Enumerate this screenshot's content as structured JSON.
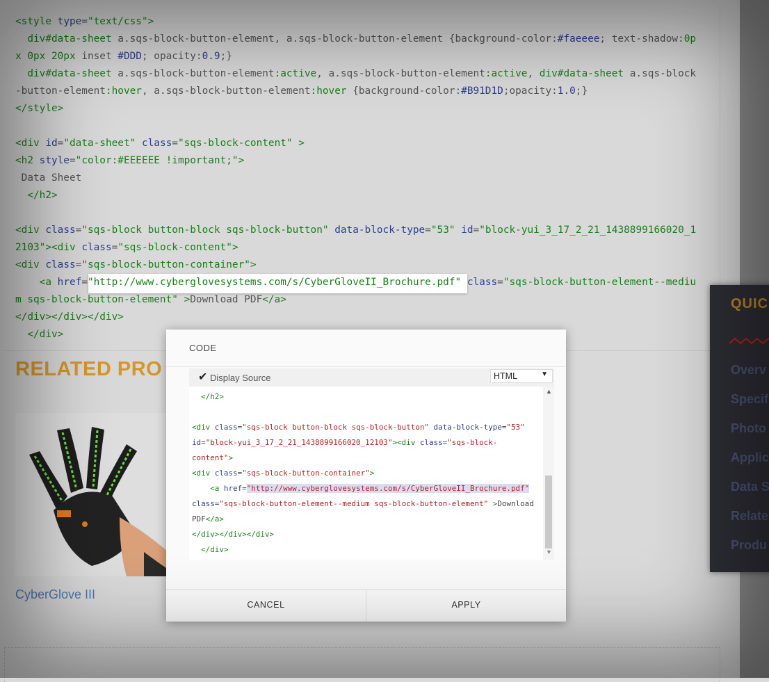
{
  "background_code": {
    "lines": [
      [
        {
          "c": "t",
          "v": "<style "
        },
        {
          "c": "a",
          "v": "type"
        },
        {
          "c": "p",
          "v": "="
        },
        {
          "c": "s",
          "v": "\"text/css\""
        },
        {
          "c": "t",
          "v": ">"
        }
      ],
      [
        {
          "c": "p",
          "v": "  "
        },
        {
          "c": "t",
          "v": "div#data-sheet"
        },
        {
          "c": "p",
          "v": " a.sqs-block-button-element, a.sqs-block-button-element "
        },
        {
          "c": "p",
          "v": "{background-color:"
        },
        {
          "c": "k",
          "v": "#faeeee"
        },
        {
          "c": "p",
          "v": "; text-shadow:"
        },
        {
          "c": "t",
          "v": "0p"
        }
      ],
      [
        {
          "c": "t",
          "v": "x 0px 20px"
        },
        {
          "c": "p",
          "v": " inset "
        },
        {
          "c": "k",
          "v": "#DDD"
        },
        {
          "c": "p",
          "v": "; opacity:"
        },
        {
          "c": "k",
          "v": "0.9"
        },
        {
          "c": "p",
          "v": ";}"
        }
      ],
      [
        {
          "c": "p",
          "v": "  "
        },
        {
          "c": "t",
          "v": "div#data-sheet"
        },
        {
          "c": "p",
          "v": " a.sqs-block-button-element"
        },
        {
          "c": "t",
          "v": ":active"
        },
        {
          "c": "p",
          "v": ", a.sqs-block-button-element"
        },
        {
          "c": "t",
          "v": ":active"
        },
        {
          "c": "p",
          "v": ", "
        },
        {
          "c": "t",
          "v": "div#data-sheet"
        },
        {
          "c": "p",
          "v": " a.sqs-block"
        }
      ],
      [
        {
          "c": "p",
          "v": "-button-element"
        },
        {
          "c": "t",
          "v": ":hover"
        },
        {
          "c": "p",
          "v": ", a.sqs-block-button-element"
        },
        {
          "c": "t",
          "v": ":hover"
        },
        {
          "c": "p",
          "v": " {background-color:"
        },
        {
          "c": "k",
          "v": "#B91D1D"
        },
        {
          "c": "p",
          "v": ";opacity:"
        },
        {
          "c": "k",
          "v": "1.0"
        },
        {
          "c": "p",
          "v": ";}"
        }
      ],
      [
        {
          "c": "t",
          "v": "</style>"
        }
      ],
      [],
      [
        {
          "c": "t",
          "v": "<div "
        },
        {
          "c": "a",
          "v": "id"
        },
        {
          "c": "p",
          "v": "="
        },
        {
          "c": "s",
          "v": "\"data-sheet\""
        },
        {
          "c": "p",
          "v": " "
        },
        {
          "c": "a",
          "v": "class"
        },
        {
          "c": "p",
          "v": "="
        },
        {
          "c": "s",
          "v": "\"sqs-block-content\""
        },
        {
          "c": "t",
          "v": " >"
        }
      ],
      [
        {
          "c": "t",
          "v": "<h2 "
        },
        {
          "c": "a",
          "v": "style"
        },
        {
          "c": "p",
          "v": "="
        },
        {
          "c": "s",
          "v": "\"color:#EEEEEE !important;\""
        },
        {
          "c": "t",
          "v": ">"
        }
      ],
      [
        {
          "c": "p",
          "v": " Data Sheet"
        }
      ],
      [
        {
          "c": "t",
          "v": "  </h2>"
        }
      ],
      [],
      [
        {
          "c": "t",
          "v": "<div "
        },
        {
          "c": "a",
          "v": "class"
        },
        {
          "c": "p",
          "v": "="
        },
        {
          "c": "s",
          "v": "\"sqs-block button-block sqs-block-button\""
        },
        {
          "c": "p",
          "v": " "
        },
        {
          "c": "a",
          "v": "data-block-type"
        },
        {
          "c": "p",
          "v": "="
        },
        {
          "c": "s",
          "v": "\"53\""
        },
        {
          "c": "p",
          "v": " "
        },
        {
          "c": "a",
          "v": "id"
        },
        {
          "c": "p",
          "v": "="
        },
        {
          "c": "s",
          "v": "\"block-yui_3_17_2_21_1438899166020_1"
        }
      ],
      [
        {
          "c": "s",
          "v": "2103\""
        },
        {
          "c": "t",
          "v": "><div "
        },
        {
          "c": "a",
          "v": "class"
        },
        {
          "c": "p",
          "v": "="
        },
        {
          "c": "s",
          "v": "\"sqs-block-content\""
        },
        {
          "c": "t",
          "v": ">"
        }
      ],
      [
        {
          "c": "t",
          "v": "<div "
        },
        {
          "c": "a",
          "v": "class"
        },
        {
          "c": "p",
          "v": "="
        },
        {
          "c": "s",
          "v": "\"sqs-block-button-container\""
        },
        {
          "c": "t",
          "v": ">"
        }
      ],
      [
        {
          "c": "p",
          "v": "    "
        },
        {
          "c": "t",
          "v": "<a "
        },
        {
          "c": "a",
          "v": "href"
        },
        {
          "c": "p",
          "v": "="
        },
        {
          "c": "s",
          "v": "\"http://www.cyberglovesystems.com/s/CyberGloveII_Brochure.pdf\""
        },
        {
          "c": "p",
          "v": " "
        },
        {
          "c": "a",
          "v": "class"
        },
        {
          "c": "p",
          "v": "="
        },
        {
          "c": "s",
          "v": "\"sqs-block-button-element--mediu"
        }
      ],
      [
        {
          "c": "s",
          "v": "m sqs-block-button-element\""
        },
        {
          "c": "t",
          "v": " >"
        },
        {
          "c": "p",
          "v": "Download PDF"
        },
        {
          "c": "t",
          "v": "</a>"
        }
      ],
      [
        {
          "c": "t",
          "v": "</div></div></div>"
        }
      ],
      [
        {
          "c": "t",
          "v": "  </div>"
        }
      ]
    ]
  },
  "related": {
    "title": "RELATED PRO",
    "product_name": "CyberGlove III"
  },
  "quick_nav": {
    "title": "QUIC",
    "items": [
      "Overv",
      "Specif",
      "Photo",
      "Applic",
      "Data S",
      "Relate",
      "Produ"
    ]
  },
  "modal": {
    "title": "CODE",
    "display_source_label": "Display Source",
    "display_source_checked": true,
    "mode_value": "HTML",
    "cancel_label": "CANCEL",
    "apply_label": "APPLY",
    "editor_lines": [
      [
        {
          "c": "t",
          "v": "  </h2>"
        }
      ],
      [],
      [
        {
          "c": "t",
          "v": "<div "
        },
        {
          "c": "a",
          "v": "class"
        },
        {
          "c": "p",
          "v": "="
        },
        {
          "c": "s",
          "v": "\"sqs-block button-block sqs-block-button\""
        },
        {
          "c": "p",
          "v": " "
        },
        {
          "c": "a",
          "v": "data-block-type"
        },
        {
          "c": "p",
          "v": "="
        },
        {
          "c": "s",
          "v": "\"53\""
        }
      ],
      [
        {
          "c": "a",
          "v": "id"
        },
        {
          "c": "p",
          "v": "="
        },
        {
          "c": "s",
          "v": "\"block-yui_3_17_2_21_1438899166020_12103\""
        },
        {
          "c": "t",
          "v": "><div "
        },
        {
          "c": "a",
          "v": "class"
        },
        {
          "c": "p",
          "v": "="
        },
        {
          "c": "s",
          "v": "\"sqs-block-"
        }
      ],
      [
        {
          "c": "s",
          "v": "content\""
        },
        {
          "c": "t",
          "v": ">"
        }
      ],
      [
        {
          "c": "t",
          "v": "<div "
        },
        {
          "c": "a",
          "v": "class"
        },
        {
          "c": "p",
          "v": "="
        },
        {
          "c": "s",
          "v": "\"sqs-block-button-container\""
        },
        {
          "c": "t",
          "v": ">"
        }
      ],
      [
        {
          "c": "p",
          "v": "    "
        },
        {
          "c": "t",
          "v": "<a "
        },
        {
          "c": "a",
          "v": "href"
        },
        {
          "c": "p",
          "v": "="
        },
        {
          "c": "s",
          "v": "\"http://www.cyberglovesystems.com/s/CyberGloveII_Brochure.pdf\"",
          "hl": true
        }
      ],
      [
        {
          "c": "a",
          "v": "class"
        },
        {
          "c": "p",
          "v": "="
        },
        {
          "c": "s",
          "v": "\"sqs-block-button-element--medium sqs-block-button-element\""
        },
        {
          "c": "p",
          "v": " "
        },
        {
          "c": "t",
          "v": ">"
        },
        {
          "c": "p",
          "v": "Download"
        }
      ],
      [
        {
          "c": "p",
          "v": "PDF"
        },
        {
          "c": "t",
          "v": "</a>"
        }
      ],
      [
        {
          "c": "t",
          "v": "</div></div></div>"
        }
      ],
      [
        {
          "c": "t",
          "v": "  </div>"
        }
      ]
    ]
  },
  "colors": {
    "accent_orange": "#d4982a",
    "link_blue": "#4d79b3",
    "panel_dark": "#2e2e36"
  }
}
